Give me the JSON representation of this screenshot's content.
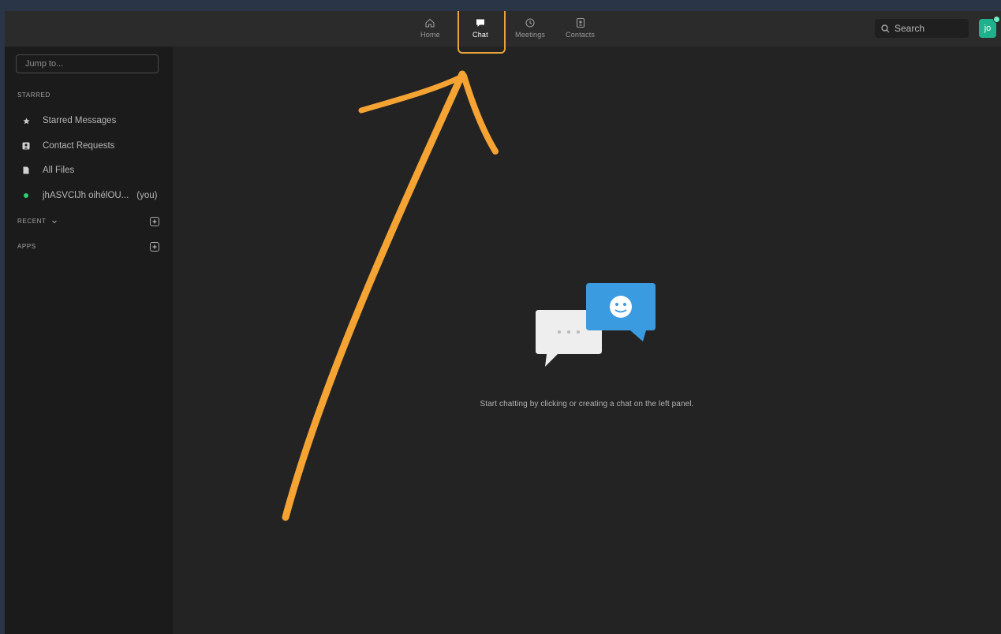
{
  "nav": {
    "tabs": [
      {
        "label": "Home",
        "icon": "home-icon"
      },
      {
        "label": "Chat",
        "icon": "chat-icon",
        "active": true
      },
      {
        "label": "Meetings",
        "icon": "clock-icon"
      },
      {
        "label": "Contacts",
        "icon": "contacts-icon"
      }
    ],
    "search_label": "Search",
    "avatar_initials": "jo"
  },
  "sidebar": {
    "jump_placeholder": "Jump to...",
    "starred_header": "STARRED",
    "items": [
      {
        "label": "Starred Messages",
        "icon": "star-icon"
      },
      {
        "label": "Contact Requests",
        "icon": "contact-card-icon"
      },
      {
        "label": "All Files",
        "icon": "file-icon"
      },
      {
        "label": "jhASVClJh oihélOU...",
        "suffix": "(you)",
        "icon": "presence-dot-icon"
      }
    ],
    "recent_header": "RECENT",
    "apps_header": "APPS"
  },
  "main": {
    "empty_message": "Start chatting by clicking or creating a chat on the left panel."
  },
  "colors": {
    "highlight": "#e8a43a",
    "annotation_arrow": "#f5a433",
    "bubble_blue": "#3a9be0",
    "presence": "#2ecc71",
    "avatar_bg": "#1fb08c"
  }
}
